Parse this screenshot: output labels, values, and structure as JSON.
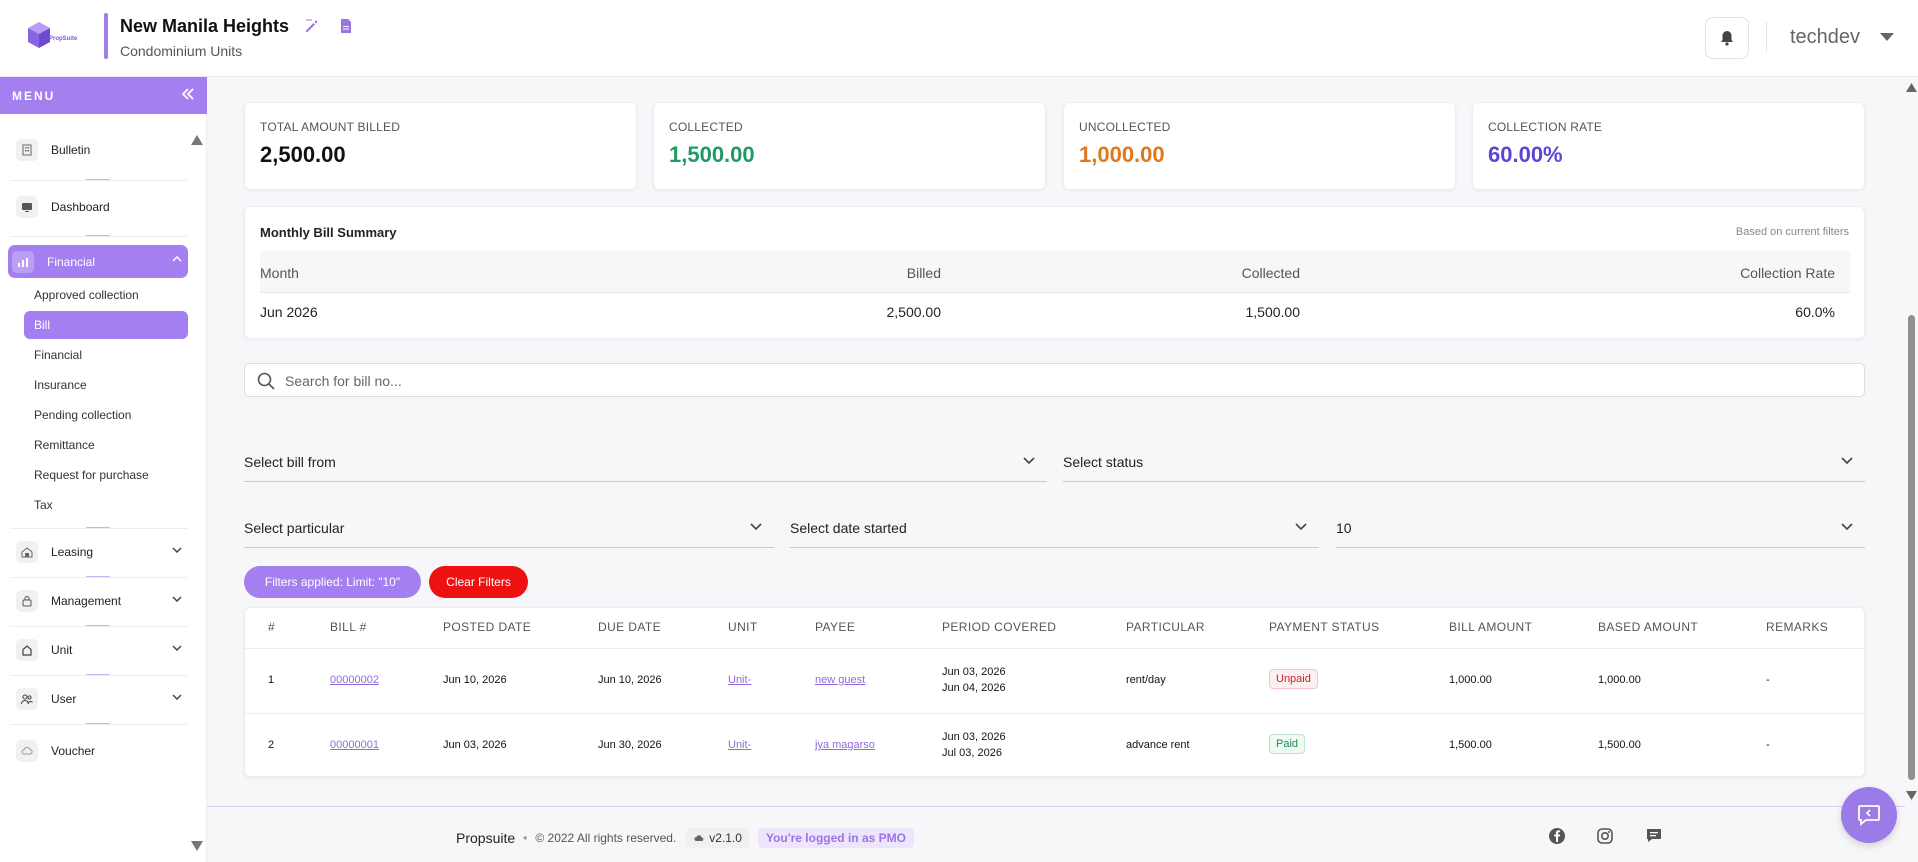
{
  "header": {
    "logo_text": "PropSuite",
    "title": "New Manila Heights",
    "subtitle": "Condominium Units",
    "user": "techdev"
  },
  "sidebar": {
    "menu_label": "MENU",
    "items": [
      {
        "label": "Bulletin",
        "icon": "building-icon"
      },
      {
        "label": "Dashboard",
        "icon": "monitor-icon"
      },
      {
        "label": "Financial",
        "icon": "chart-icon",
        "active": true
      },
      {
        "label": "Leasing",
        "icon": "house-icon"
      },
      {
        "label": "Management",
        "icon": "lock-icon"
      },
      {
        "label": "Unit",
        "icon": "home-icon"
      },
      {
        "label": "User",
        "icon": "users-icon"
      },
      {
        "label": "Voucher",
        "icon": "cloud-icon"
      }
    ],
    "financial_sub": [
      "Approved collection",
      "Bill",
      "Financial",
      "Insurance",
      "Pending collection",
      "Remittance",
      "Request for purchase",
      "Tax"
    ],
    "active_sub": "Bill"
  },
  "stats": [
    {
      "label": "TOTAL AMOUNT BILLED",
      "value": "2,500.00",
      "color": "#111111"
    },
    {
      "label": "COLLECTED",
      "value": "1,500.00",
      "color": "#1f9a64"
    },
    {
      "label": "UNCOLLECTED",
      "value": "1,000.00",
      "color": "#e0771b"
    },
    {
      "label": "COLLECTION RATE",
      "value": "60.00%",
      "color": "#5b45d6"
    }
  ],
  "summary": {
    "title": "Monthly Bill Summary",
    "note": "Based on current filters",
    "headers": [
      "Month",
      "Billed",
      "Collected",
      "Collection Rate"
    ],
    "row": [
      "Jun 2026",
      "2,500.00",
      "1,500.00",
      "60.0%"
    ]
  },
  "search": {
    "placeholder": "Search for bill no..."
  },
  "filters": {
    "bill_from": "Select bill from",
    "status": "Select status",
    "particular": "Select particular",
    "date_started": "Select date started",
    "limit": "10",
    "applied": "Filters applied:   Limit: \"10\"",
    "clear": "Clear Filters"
  },
  "table": {
    "headers": [
      "#",
      "BILL #",
      "POSTED DATE",
      "DUE DATE",
      "UNIT",
      "PAYEE",
      "PERIOD COVERED",
      "PARTICULAR",
      "PAYMENT STATUS",
      "BILL AMOUNT",
      "BASED AMOUNT",
      "REMARKS"
    ],
    "rows": [
      {
        "num": "1",
        "bill": "00000002",
        "posted": "Jun 10, 2026",
        "due": "Jun 10, 2026",
        "unit": "Unit-",
        "payee": "new guest",
        "period_start": "Jun 03, 2026",
        "period_end": "Jun 04, 2026",
        "particular": "rent/day",
        "status": "Unpaid",
        "bill_amount": "1,000.00",
        "based_amount": "1,000.00",
        "remarks": "-"
      },
      {
        "num": "2",
        "bill": "00000001",
        "posted": "Jun 03, 2026",
        "due": "Jun 30, 2026",
        "unit": "Unit-",
        "payee": "jya magarso",
        "period_start": "Jun 03, 2026",
        "period_end": "Jul 03, 2026",
        "particular": "advance rent",
        "status": "Paid",
        "bill_amount": "1,500.00",
        "based_amount": "1,500.00",
        "remarks": "-"
      }
    ]
  },
  "footer": {
    "brand": "Propsuite",
    "copyright": "© 2022 All rights reserved.",
    "version": "v2.1.0",
    "logged_in": "You're logged in as PMO"
  },
  "colors": {
    "accent": "#a47ff0",
    "danger": "#ee1111"
  }
}
